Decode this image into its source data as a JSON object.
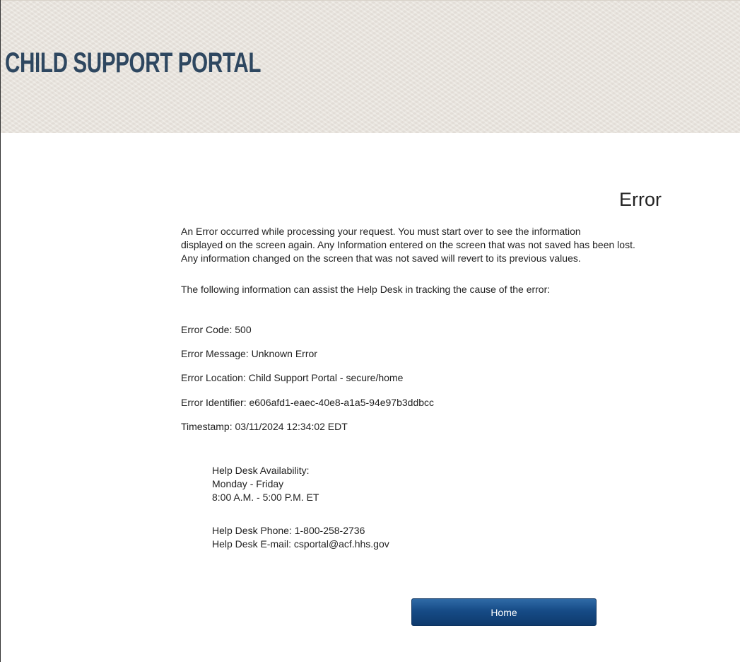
{
  "header": {
    "title": "CHILD SUPPORT PORTAL"
  },
  "error_page": {
    "heading": "Error",
    "intro_lines": [
      "An Error occurred while processing your request. You must start over to see the information",
      "displayed on the screen again. Any Information entered on the screen that was not saved has been lost.",
      "Any information changed on the screen that was not saved will revert to its previous values."
    ],
    "assist_text": "The following information can assist the Help Desk in tracking the cause of the error:",
    "details": {
      "code": "Error Code: 500",
      "message": "Error Message: Unknown Error",
      "location": "Error Location: Child Support Portal - secure/home",
      "identifier": "Error Identifier: e606afd1-eaec-40e8-a1a5-94e97b3ddbcc",
      "timestamp": "Timestamp: 03/11/2024 12:34:02 EDT"
    },
    "help_desk": {
      "availability_label": "Help Desk Availability:",
      "days": "Monday - Friday",
      "hours": "8:00 A.M. - 5:00 P.M. ET",
      "phone": "Help Desk Phone: 1-800-258-2736",
      "email": "Help Desk E-mail: csportal@acf.hhs.gov"
    },
    "home_button_label": "Home"
  }
}
